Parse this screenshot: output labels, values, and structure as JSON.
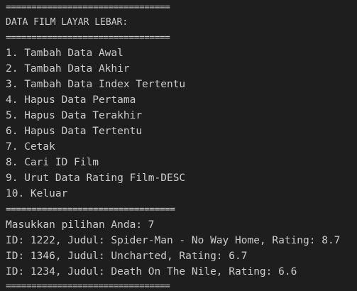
{
  "terminal": {
    "sep_top": "================================",
    "header": "DATA FILM LAYAR LEBAR:",
    "sep_header": "================================",
    "menu": [
      "1. Tambah Data Awal",
      "2. Tambah Data Akhir",
      "3. Tambah Data Index Tertentu",
      "4. Hapus Data Pertama",
      "5. Hapus Data Terakhir",
      "6. Hapus Data Tertentu",
      "7. Cetak",
      "8. Cari ID Film",
      "9. Urut Data Rating Film-DESC",
      "10. Keluar"
    ],
    "sep_menu": "=================================",
    "prompt": "Masukkan pilihan Anda: 7",
    "results": [
      "ID: 1222, Judul: Spider-Man - No Way Home, Rating: 8.7",
      "ID: 1346, Judul: Uncharted, Rating: 6.7",
      "ID: 1234, Judul: Death On The Nile, Rating: 6.6"
    ],
    "sep_bottom": "================================"
  }
}
